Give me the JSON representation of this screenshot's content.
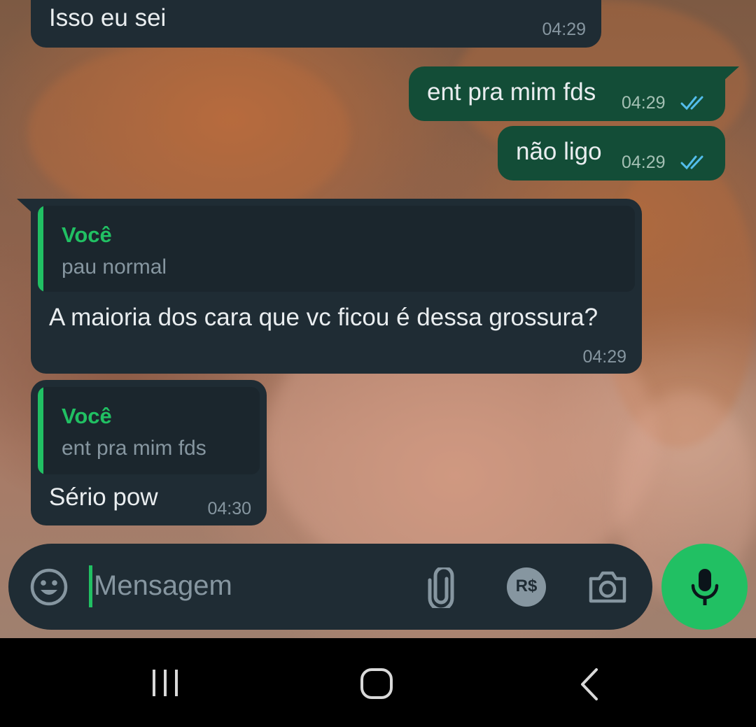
{
  "messages": [
    {
      "direction": "in",
      "text": "Isso eu sei",
      "time": "04:29"
    },
    {
      "direction": "out",
      "text": "ent pra mim fds",
      "time": "04:29",
      "status": "read"
    },
    {
      "direction": "out",
      "text": "não ligo",
      "time": "04:29",
      "status": "read"
    },
    {
      "direction": "in",
      "quote": {
        "author": "Você",
        "text": "pau normal"
      },
      "text": "A maioria dos cara que vc ficou é dessa grossura?",
      "time": "04:29"
    },
    {
      "direction": "in",
      "quote": {
        "author": "Você",
        "text": "ent pra mim fds"
      },
      "text": "Sério pow",
      "time": "04:30"
    }
  ],
  "composer": {
    "placeholder": "Mensagem",
    "icons": [
      "emoji-icon",
      "attach-icon",
      "payment-icon",
      "camera-icon"
    ],
    "payment_label": "R$",
    "send_icon": "mic-icon"
  },
  "navigation": {
    "buttons": [
      "recent-apps-icon",
      "home-icon",
      "back-icon"
    ]
  },
  "colors": {
    "incoming_bubble": "#1f2c34",
    "outgoing_bubble": "#134d37",
    "accent": "#21c063",
    "read_check": "#53bdeb",
    "timestamp": "#8696a0"
  }
}
